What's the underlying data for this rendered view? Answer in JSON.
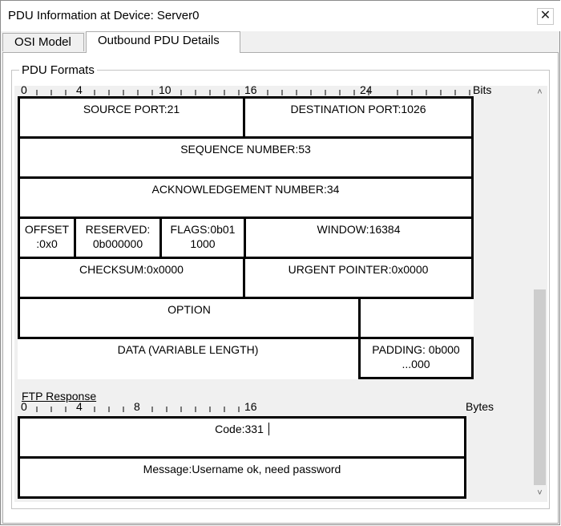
{
  "window": {
    "title": "PDU Information at Device: Server0",
    "close_glyph": "✕"
  },
  "tabs": [
    {
      "label": "OSI Model",
      "active": false
    },
    {
      "label": "Outbound PDU Details",
      "active": true
    }
  ],
  "group": {
    "legend": "PDU Formats"
  },
  "tcp": {
    "ruler": {
      "marks": [
        "0",
        "4",
        "10",
        "16",
        "24"
      ],
      "unit": "Bits"
    },
    "source_port": "SOURCE PORT:21",
    "destination_port": "DESTINATION PORT:1026",
    "sequence_number": "SEQUENCE NUMBER:53",
    "ack_number": "ACKNOWLEDGEMENT NUMBER:34",
    "offset": "OFFSET :0x0",
    "reserved": "RESERVED: 0b000000",
    "flags": "FLAGS:0b01 1000",
    "window": "WINDOW:16384",
    "checksum": "CHECKSUM:0x0000",
    "urgent_pointer": "URGENT POINTER:0x0000",
    "option": "OPTION",
    "data": "DATA (VARIABLE LENGTH)",
    "padding": "PADDING: 0b000 ...000"
  },
  "ftp": {
    "title": "FTP Response",
    "ruler": {
      "marks": [
        "0",
        "4",
        "8",
        "16"
      ],
      "unit": "Bytes"
    },
    "code": "Code:331",
    "message": "Message:Username ok, need password"
  },
  "scrollbar": {
    "up_glyph": "˄",
    "down_glyph": "˅"
  }
}
